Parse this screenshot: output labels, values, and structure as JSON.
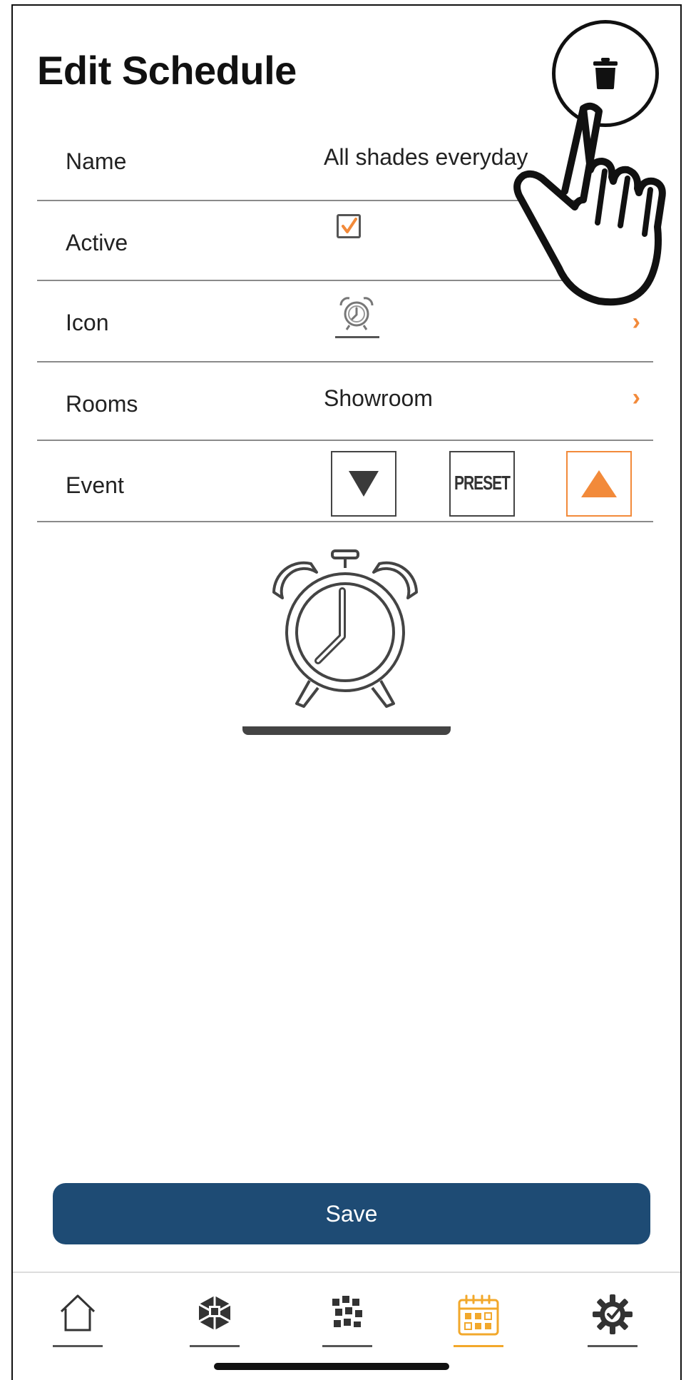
{
  "header": {
    "title": "Edit Schedule",
    "delete_icon": "trash-icon"
  },
  "form": {
    "name_label": "Name",
    "name_value": "All shades everyday",
    "active_label": "Active",
    "active_checked": true,
    "icon_label": "Icon",
    "icon_value": "alarm-clock-icon",
    "rooms_label": "Rooms",
    "rooms_value": "Showroom",
    "event_label": "Event",
    "event_options": [
      {
        "id": "down",
        "icon": "triangle-down-icon",
        "selected": false
      },
      {
        "id": "preset",
        "label": "PRESET",
        "selected": false
      },
      {
        "id": "up",
        "icon": "triangle-up-icon",
        "selected": true
      }
    ]
  },
  "preview_icon": "alarm-clock-icon",
  "save_label": "Save",
  "tabbar": {
    "items": [
      {
        "id": "home",
        "icon": "home-icon",
        "active": false
      },
      {
        "id": "devices",
        "icon": "cube-icon",
        "active": false
      },
      {
        "id": "scenes",
        "icon": "grid-icon",
        "active": false
      },
      {
        "id": "schedules",
        "icon": "calendar-icon",
        "active": true
      },
      {
        "id": "settings",
        "icon": "gear-check-icon",
        "active": false
      }
    ]
  },
  "colors": {
    "accent": "#f28a3a",
    "primary": "#1e4b74",
    "active_tab": "#f2a82b"
  }
}
